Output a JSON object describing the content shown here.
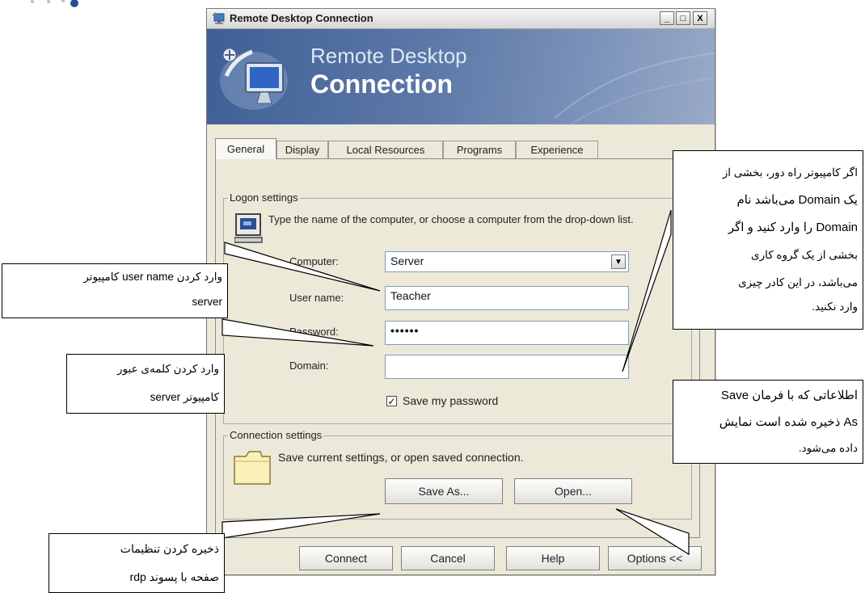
{
  "window": {
    "title": "Remote Desktop Connection",
    "banner_line1": "Remote Desktop",
    "banner_line2": "Connection",
    "controls": {
      "minimize": "_",
      "maximize": "□",
      "close": "X"
    }
  },
  "tabs": [
    {
      "label": "General",
      "active": true
    },
    {
      "label": "Display",
      "active": false
    },
    {
      "label": "Local Resources",
      "active": false
    },
    {
      "label": "Programs",
      "active": false
    },
    {
      "label": "Experience",
      "active": false
    }
  ],
  "logon_settings": {
    "legend": "Logon settings",
    "description": "Type the name of the computer, or choose a computer from the drop-down list.",
    "computer_label": "Computer:",
    "computer_value": "Server",
    "username_label": "User name:",
    "username_value": "Teacher",
    "password_label": "Password:",
    "password_value": "••••••",
    "domain_label": "Domain:",
    "domain_value": "",
    "save_password_label": "Save my password",
    "save_password_checked": true
  },
  "connection_settings": {
    "legend": "Connection settings",
    "description": "Save current settings, or open saved connection.",
    "save_as_label": "Save As...",
    "open_label": "Open..."
  },
  "footer_buttons": {
    "connect": "Connect",
    "cancel": "Cancel",
    "help": "Help",
    "options": "Options <<"
  },
  "callouts": {
    "username": {
      "line1": "وارد کردن user name کامپیوتر",
      "line2": "server"
    },
    "password": {
      "line1": "وارد کردن کلمه‌ی عبور",
      "line2": "کامپیوتر server"
    },
    "save_settings": {
      "line1": "ذخیره کردن تنظیمات",
      "line2": "صفحه با پسوند rdp"
    },
    "domain": {
      "line1": "اگر کامپیوتر راه دور، بخشی از",
      "line2": "یک Domain می‌باشد نام",
      "line3": "Domain را وارد کنید و اگر",
      "line4": "بخشی از یک گروه کاری",
      "line5": "می‌باشد، در این کادر چیزی",
      "line6": "وارد نکنید."
    },
    "open": {
      "line1": "اطلاعاتی که با فرمان Save",
      "line2": "As ذخیره شده است نمایش",
      "line3": "داده می‌شود."
    }
  },
  "colors": {
    "banner_start": "#3f5f95",
    "banner_end": "#9aaac7",
    "dialog_face": "#ece9d8",
    "field_border": "#7f9db9"
  }
}
